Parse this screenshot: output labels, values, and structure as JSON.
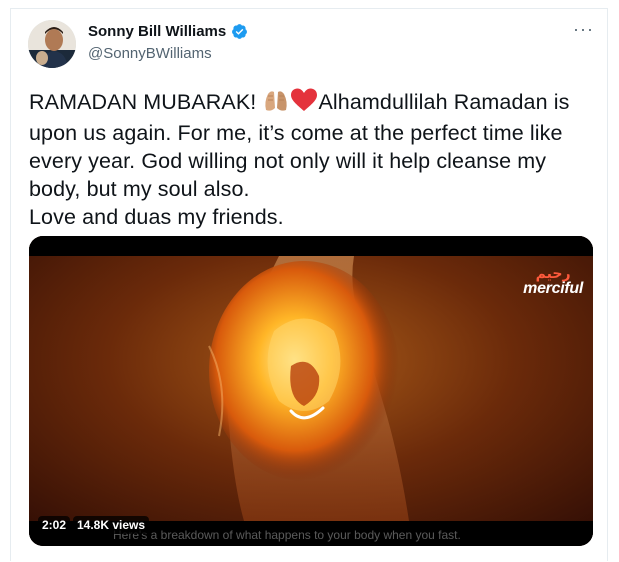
{
  "author": {
    "display_name": "Sonny Bill Williams",
    "handle": "@SonnyBWilliams",
    "verified": true,
    "avatar_icon": "profile-photo"
  },
  "menu": {
    "more_label": "···"
  },
  "tweet": {
    "line1_a": "RAMADAN MUBARAK! ",
    "line1_emoji_1": "praying-hands-emoji",
    "line1_emoji_2": "red-heart-emoji",
    "line1_b": "Alhamdullilah Ramadan is upon us again. For me, it’s come at the perfect time like every year. God willing not only will it help cleanse my body, but my soul also.",
    "line2": "Love and duas my friends."
  },
  "video": {
    "duration": "2:02",
    "views": "14.8K views",
    "watermark_brand": "merciful",
    "watermark_arabic": "رحيم",
    "subtitle": "Here's a breakdown of what happens to your body when you fast."
  },
  "colors": {
    "verified": "#1d9bf0",
    "text": "#0f1419",
    "secondary": "#536471"
  }
}
